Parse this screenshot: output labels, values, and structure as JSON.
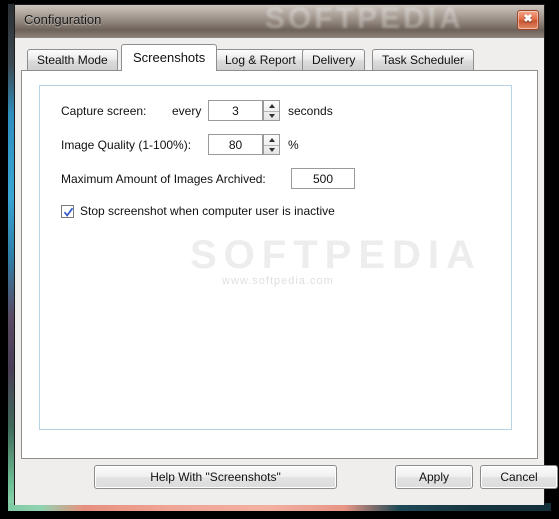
{
  "window": {
    "title": "Configuration",
    "close_label": "✖",
    "title_watermark": "SOFTPEDIA"
  },
  "tabs": [
    {
      "label": "Stealth Mode",
      "active": false
    },
    {
      "label": "Screenshots",
      "active": true
    },
    {
      "label": "Log & Report",
      "active": false
    },
    {
      "label": "Delivery",
      "active": false
    },
    {
      "label": "Task Scheduler",
      "active": false
    }
  ],
  "form": {
    "capture": {
      "label": "Capture screen:",
      "every_label": "every",
      "value": "3",
      "unit_label": "seconds"
    },
    "quality": {
      "label": "Image Quality (1-100%):",
      "value": "80",
      "unit_label": "%"
    },
    "archived": {
      "label": "Maximum Amount of Images Archived:",
      "value": "500"
    },
    "stop_inactive": {
      "label": "Stop screenshot when computer user is inactive",
      "checked": true
    }
  },
  "watermarks": {
    "big": "SOFTPEDIA",
    "small": "www.softpedia.com"
  },
  "footer": {
    "help_label": "Help With \"Screenshots\"",
    "apply_label": "Apply",
    "cancel_label": "Cancel"
  },
  "colors": {
    "accent_blue": "#2f8fbf",
    "close_red": "#e3704a",
    "group_border": "#b9d2e4",
    "check_blue": "#3a5fc8"
  }
}
